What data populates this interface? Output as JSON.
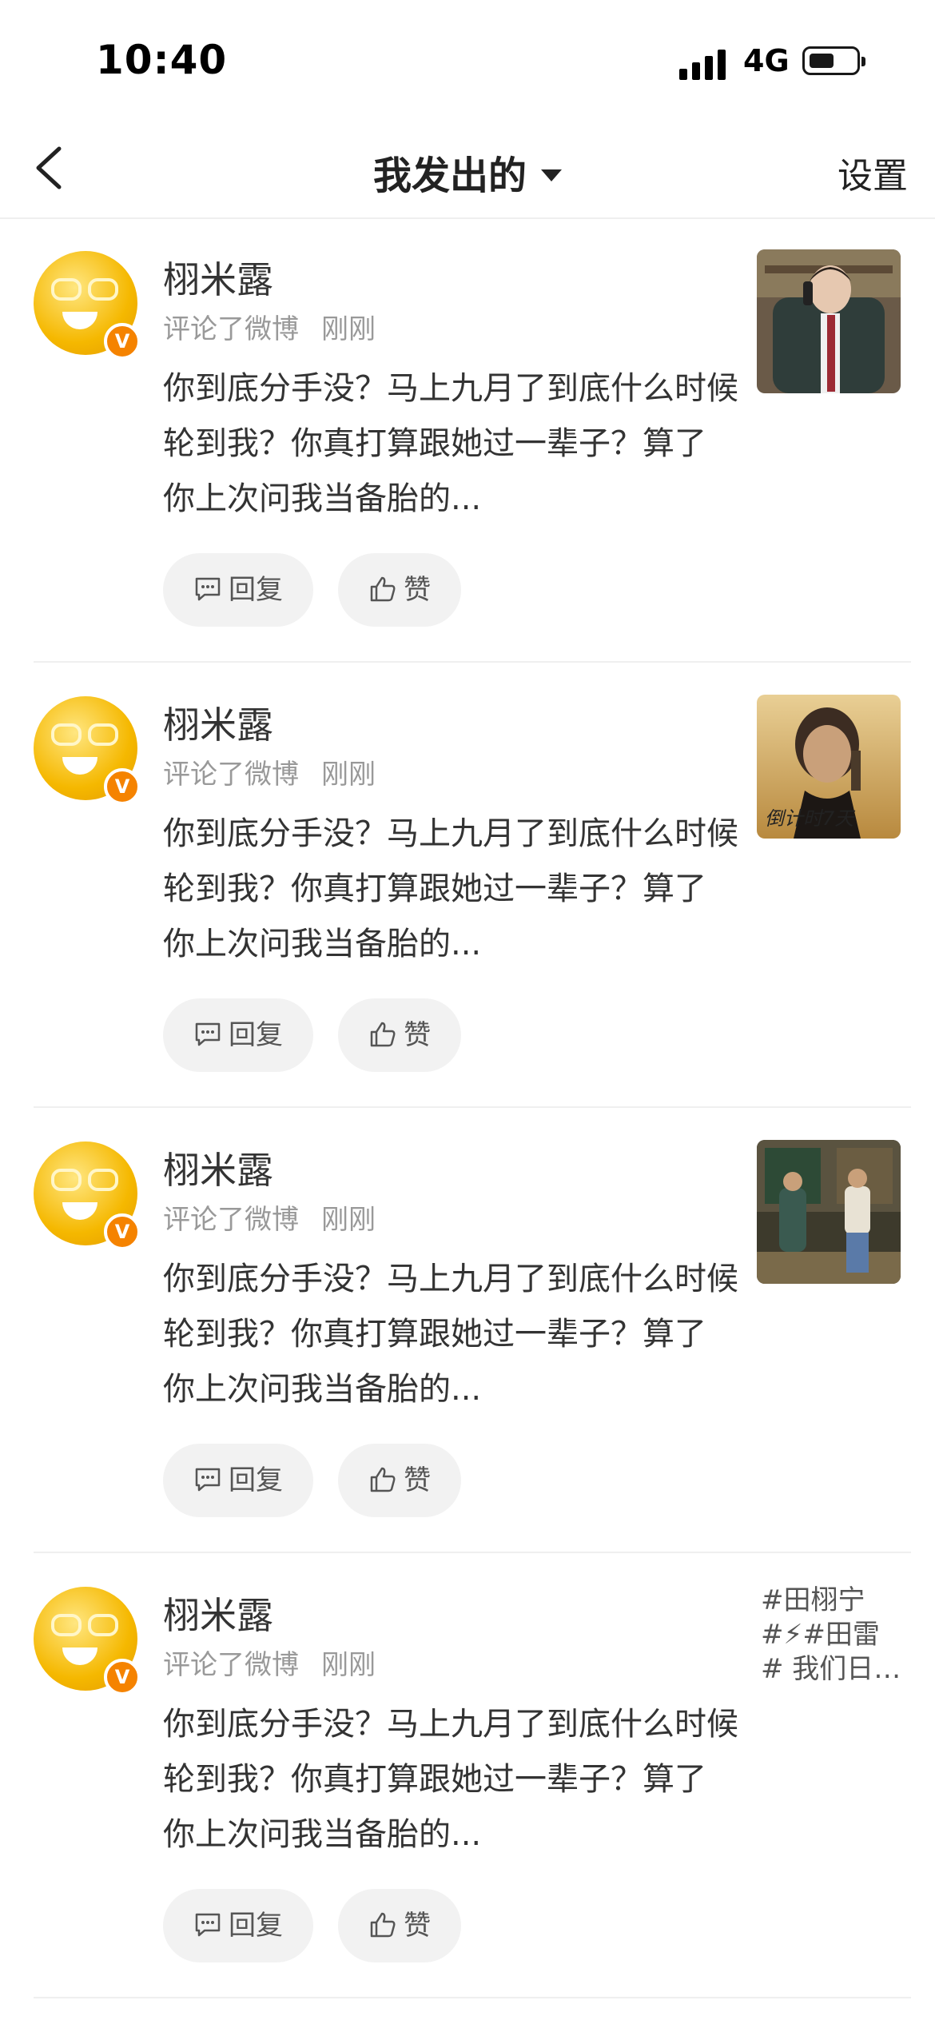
{
  "status": {
    "time": "10:40",
    "network": "4G"
  },
  "nav": {
    "title": "我发出的",
    "settings": "设置"
  },
  "items": [
    {
      "name": "栩米露",
      "action": "评论了微博",
      "when": "刚刚",
      "content": "你到底分手没？马上九月了到底什么时候轮到我？你真打算跟她过一辈子？算了 你上次问我当备胎的...",
      "reply": "回复",
      "like": "赞",
      "thumb": "thumb-1"
    },
    {
      "name": "栩米露",
      "action": "评论了微博",
      "when": "刚刚",
      "content": "你到底分手没？马上九月了到底什么时候轮到我？你真打算跟她过一辈子？算了 你上次问我当备胎的...",
      "reply": "回复",
      "like": "赞",
      "thumb": "thumb-2",
      "thumb_text": "倒计时7天"
    },
    {
      "name": "栩米露",
      "action": "评论了微博",
      "when": "刚刚",
      "content": "你到底分手没？马上九月了到底什么时候轮到我？你真打算跟她过一辈子？算了 你上次问我当备胎的...",
      "reply": "回复",
      "like": "赞",
      "thumb": "thumb-3"
    },
    {
      "name": "栩米露",
      "action": "评论了微博",
      "when": "刚刚",
      "content": "你到底分手没？马上九月了到底什么时候轮到我？你真打算跟她过一辈子？算了 你上次问我当备胎的...",
      "reply": "回复",
      "like": "赞",
      "tags": [
        "#田栩宁",
        "#⚡#田雷",
        "# 我们日…"
      ]
    }
  ]
}
